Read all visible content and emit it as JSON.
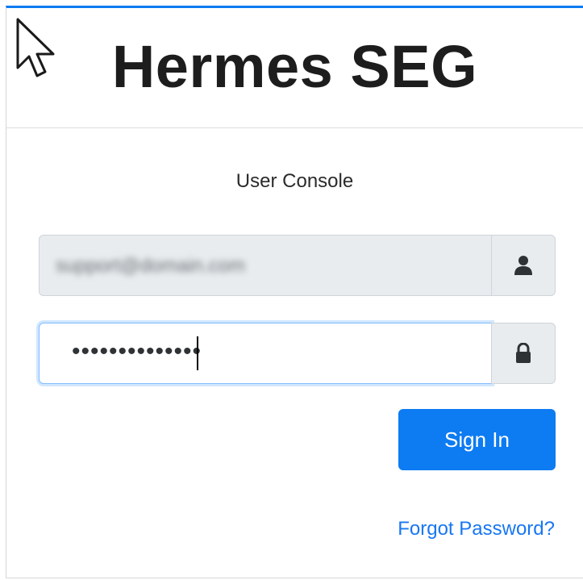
{
  "header": {
    "title": "Hermes SEG"
  },
  "form": {
    "subtitle": "User Console",
    "username": {
      "value": "support@domain.com",
      "icon": "user-icon"
    },
    "password": {
      "masked": "••••••••••••••",
      "icon": "lock-icon"
    },
    "sign_in_label": "Sign In",
    "forgot_label": "Forgot Password?"
  },
  "colors": {
    "accent": "#0d7bf2",
    "link": "#1877f2",
    "addon_bg": "#e9ecef"
  }
}
